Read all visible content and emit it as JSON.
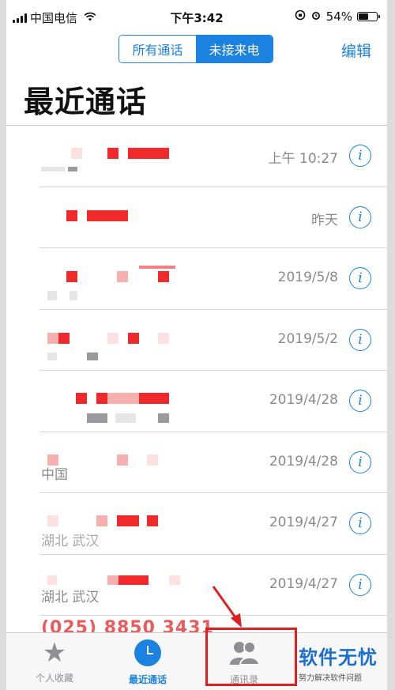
{
  "status_bar": {
    "carrier": "中国电信",
    "time": "下午3:42",
    "battery": "54%",
    "battery_level": 0.54
  },
  "header": {
    "segments": [
      "所有通话",
      "未接来电"
    ],
    "active_segment": "未接来电",
    "edit_label": "编辑",
    "title": "最近通话"
  },
  "calls": [
    {
      "time": "上午 10:27",
      "sub": ""
    },
    {
      "time": "昨天",
      "sub": ""
    },
    {
      "time": "2019/5/8",
      "sub": ""
    },
    {
      "time": "2019/5/2",
      "sub": ""
    },
    {
      "time": "2019/4/28",
      "sub": ""
    },
    {
      "time": "2019/4/28",
      "sub": "中国"
    },
    {
      "time": "2019/4/27",
      "sub": "湖北 武汉"
    },
    {
      "time": "2019/4/27",
      "sub": "湖北 武汉"
    }
  ],
  "info_glyph": "i",
  "partial_number": "(025) 8850 3431",
  "tabbar": {
    "tabs": [
      {
        "label": "个人收藏",
        "icon": "star-icon"
      },
      {
        "label": "最近通话",
        "icon": "clock-icon"
      },
      {
        "label": "通讯录",
        "icon": "contacts-icon"
      }
    ],
    "active": "最近通话"
  },
  "watermark": {
    "main": "软件无忧",
    "sub": "努力解决软件问题"
  },
  "colors": {
    "accent": "#1b82e0",
    "annotation": "#e02020"
  }
}
